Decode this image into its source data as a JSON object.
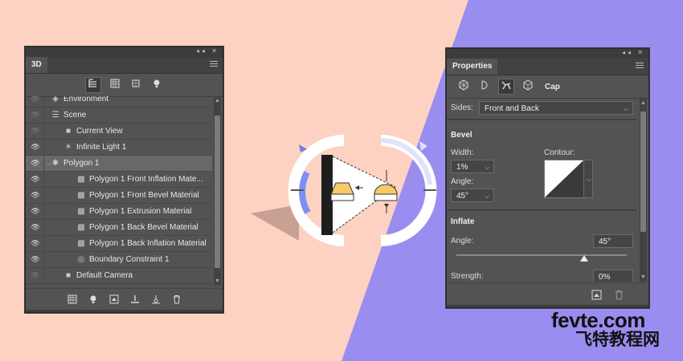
{
  "colors": {
    "background_left": "#fdd2c2",
    "background_right": "#9a8df0",
    "panel": "#535353",
    "selected_row": "#686868"
  },
  "panel_3d": {
    "tab": "3D",
    "toolbar_icons": [
      "scene-icon",
      "mesh-icon",
      "materials-icon",
      "lights-icon"
    ],
    "rows": [
      {
        "label": "Environment",
        "icon": "environment-icon",
        "visible": false
      },
      {
        "label": "Scene",
        "icon": "scene-icon",
        "visible": false
      },
      {
        "label": "Current View",
        "icon": "camera-icon",
        "visible": false
      },
      {
        "label": "Infinite Light 1",
        "icon": "light-icon",
        "visible": true
      },
      {
        "label": "Polygon 1",
        "icon": "polygon-icon",
        "visible": true,
        "selected": true,
        "expanded": true
      },
      {
        "label": "Polygon 1 Front Inflation Mate...",
        "icon": "material-icon",
        "visible": true
      },
      {
        "label": "Polygon 1 Front Bevel Material",
        "icon": "material-icon",
        "visible": true
      },
      {
        "label": "Polygon 1 Extrusion Material",
        "icon": "material-icon",
        "visible": true
      },
      {
        "label": "Polygon 1 Back Bevel Material",
        "icon": "material-icon",
        "visible": true
      },
      {
        "label": "Polygon 1 Back Inflation Material",
        "icon": "material-icon",
        "visible": true
      },
      {
        "label": "Boundary Constraint 1",
        "icon": "constraint-icon",
        "visible": true
      },
      {
        "label": "Default Camera",
        "icon": "camera-icon",
        "visible": false
      }
    ],
    "bottom_icons": [
      "mesh-icon",
      "light-icon",
      "add-object-icon",
      "ground-icon",
      "add-light-icon",
      "trash-icon"
    ]
  },
  "panel_properties": {
    "tab": "Properties",
    "toolbar_icons": [
      "mesh-icon",
      "deform-icon",
      "cap-icon",
      "coordinates-icon"
    ],
    "active_label": "Cap",
    "sides_label": "Sides:",
    "sides_value": "Front and Back",
    "bevel_heading": "Bevel",
    "width_label": "Width:",
    "width_value": "1%",
    "contour_label": "Contour:",
    "angle_label": "Angle:",
    "angle_value": "45°",
    "inflate_heading": "Inflate",
    "inflate_angle_label": "Angle:",
    "inflate_angle_value": "45°",
    "inflate_angle_slider_fraction": 0.75,
    "strength_label": "Strength:",
    "strength_value": "0%",
    "bottom_icons": [
      "reset-icon",
      "trash-icon"
    ]
  },
  "watermark": {
    "line1": "fevte.com",
    "line2": "飞特教程网"
  }
}
